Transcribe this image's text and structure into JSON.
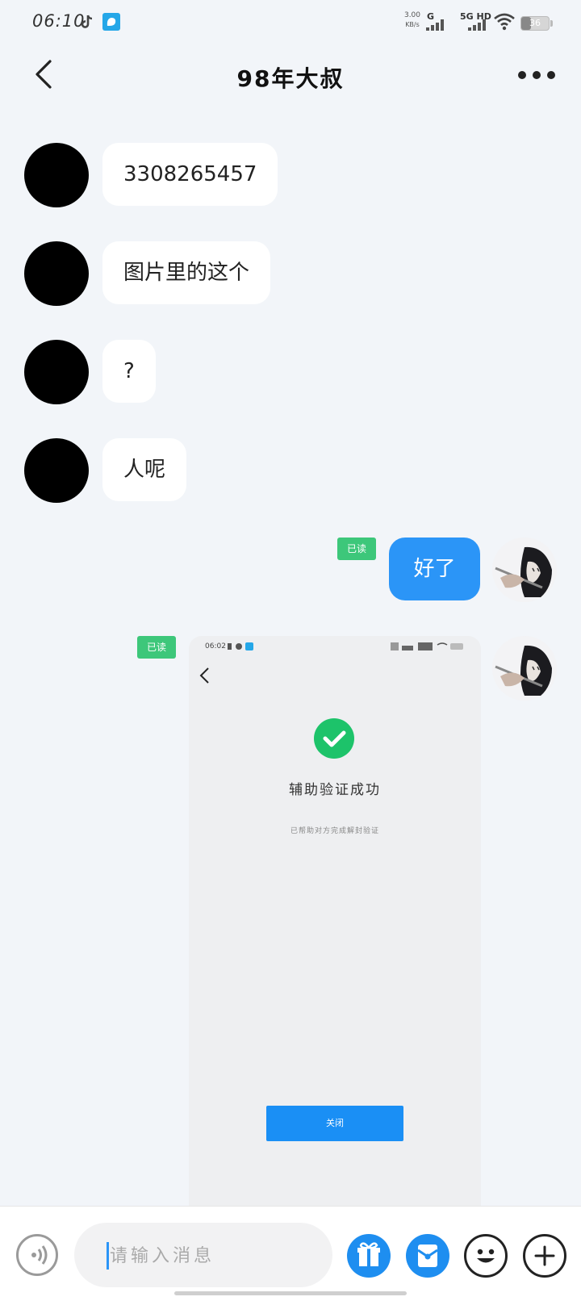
{
  "status_bar": {
    "time": "06:10",
    "net_speed": "3.00",
    "net_speed_unit": "KB/s",
    "network_g": "G",
    "network_5g": "5G HD",
    "battery": "36"
  },
  "header": {
    "title": "98年大叔"
  },
  "messages": [
    {
      "side": "incoming",
      "text": "3308265457"
    },
    {
      "side": "incoming",
      "text": "图片里的这个"
    },
    {
      "side": "incoming",
      "text": "?"
    },
    {
      "side": "incoming",
      "text": "人呢"
    },
    {
      "side": "outgoing",
      "text": "好了",
      "read": "已读"
    },
    {
      "side": "outgoing",
      "type": "image",
      "read": "已读"
    }
  ],
  "screenshot_message": {
    "time": "06:02",
    "success_title": "辅助验证成功",
    "success_subtitle": "已帮助对方完成解封验证",
    "close_button": "关闭"
  },
  "input_bar": {
    "placeholder": "请输入消息"
  },
  "colors": {
    "background": "#f2f5f9",
    "outgoing_bubble": "#2b95f7",
    "read_badge": "#3dc77a",
    "success_green": "#1dc36a",
    "action_blue": "#1e8ef0"
  },
  "icons": [
    "back-arrow-icon",
    "more-icon",
    "voice-icon",
    "gift-icon",
    "red-packet-icon",
    "emoji-icon",
    "plus-icon",
    "check-icon"
  ]
}
